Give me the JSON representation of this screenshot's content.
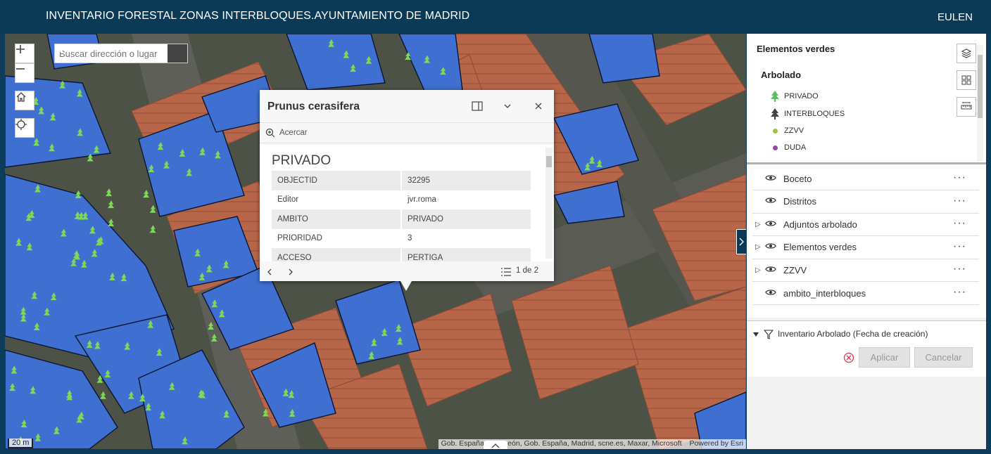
{
  "header": {
    "title": "INVENTARIO FORESTAL ZONAS INTERBLOQUES.AYUNTAMIENTO DE MADRID",
    "brand": "EULEN"
  },
  "map": {
    "search_placeholder": "Buscar dirección o lugar",
    "scale_label": "20 m",
    "attribution": "Gob. España, C. y León, Gob. España, Madrid, scne.es, Maxar, Microsoft",
    "powered_by": "Powered by Esri",
    "colors": {
      "parcel_fill": "#3f6fd0",
      "tree": "#7ed957",
      "roof": "#b8664a"
    }
  },
  "popup": {
    "title": "Prunus cerasifera",
    "zoom_label": "Acercar",
    "layer_name": "PRIVADO",
    "attributes": [
      {
        "field": "OBJECTID",
        "value": "32295"
      },
      {
        "field": "Editor",
        "value": "jvr.roma"
      },
      {
        "field": "AMBITO",
        "value": "PRIVADO"
      },
      {
        "field": "PRIORIDAD",
        "value": "3"
      },
      {
        "field": "ACCESO",
        "value": "PERTIGA"
      }
    ],
    "pager": "1 de 2"
  },
  "legend": {
    "title": "Elementos verdes",
    "subtitle": "Arbolado",
    "items": [
      {
        "label": "PRIVADO",
        "symbol": "tree-icon",
        "color": "#5bbf5b"
      },
      {
        "label": "INTERBLOQUES",
        "symbol": "tree-icon",
        "color": "#444444"
      },
      {
        "label": "ZZVV",
        "symbol": "dot",
        "color": "#9ac23c"
      },
      {
        "label": "DUDA",
        "symbol": "dot",
        "color": "#8e4aa3"
      }
    ]
  },
  "layers": [
    {
      "name": "Boceto",
      "expandable": false
    },
    {
      "name": "Distritos",
      "expandable": false
    },
    {
      "name": "Adjuntos arbolado",
      "expandable": true
    },
    {
      "name": "Elementos verdes",
      "expandable": true
    },
    {
      "name": "ZZVV",
      "expandable": true
    },
    {
      "name": "ambito_interbloques",
      "expandable": false
    }
  ],
  "filter": {
    "title": "Inventario Arbolado (Fecha de creación)",
    "apply_label": "Aplicar",
    "cancel_label": "Cancelar"
  }
}
